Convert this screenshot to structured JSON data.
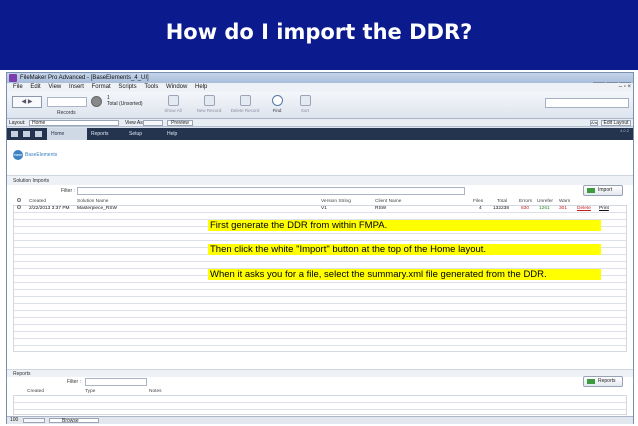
{
  "slide": {
    "title": "How do I import the DDR?"
  },
  "window": {
    "title": "FileMaker Pro Advanced - [BaseElements_4_UI]",
    "buttons": [
      "–",
      "□",
      "×"
    ],
    "menu_buttons": "– ▫ ×"
  },
  "menu": [
    "File",
    "Edit",
    "View",
    "Insert",
    "Format",
    "Scripts",
    "Tools",
    "Window",
    "Help"
  ],
  "toolbar": {
    "nav_glyphs": "◀ ▶",
    "records_label": "Records",
    "record_count": "1",
    "record_total": "Total (Unsorted)",
    "show_all": "Show All",
    "new_record": "New Record",
    "delete_record": "Delete Record",
    "find": "Find",
    "sort": "Sort"
  },
  "layoutbar": {
    "layout_label": "Layout:",
    "layout_value": "Home",
    "view_as": "View As:",
    "preview": "Preview",
    "aa": "A/a",
    "edit_layout": "Edit Layout"
  },
  "nav": {
    "tabs": [
      "Home",
      "Reports",
      "Setup",
      "Help"
    ],
    "version": "4.0.2"
  },
  "logo": {
    "mark": "base",
    "text": "BaseElements"
  },
  "imports": {
    "section_title": "Solution Imports",
    "filter_label": "Filter :",
    "import_button": "Import",
    "columns": [
      "Created",
      "Solution Name",
      "Version String",
      "Client Name",
      "Files",
      "Total",
      "Errors",
      "Unrefer",
      "Warn"
    ],
    "rows": [
      {
        "created": "2/22/2013 3:37 PM",
        "solution": "Masterpiece_RSW",
        "version": "V1",
        "client": "RSW",
        "files": "4",
        "total": "132238",
        "errors": "830",
        "unrefer": "1261",
        "warn": "301",
        "delete": "Delete",
        "print": "Print"
      }
    ]
  },
  "overlay": {
    "line1": "First generate the DDR from within FMPA.",
    "line2": "Then click the white \"Import\" button at the top of the Home layout.",
    "line3": "When it asks you for a file, select the summary.xml file generated from the DDR."
  },
  "reports": {
    "section_title": "Reports",
    "filter_label": "Filter :",
    "reports_button": "Reports",
    "columns": [
      "Created",
      "Type",
      "Notes"
    ]
  },
  "statusbar": {
    "zoom": "100",
    "mode": "Browse"
  }
}
